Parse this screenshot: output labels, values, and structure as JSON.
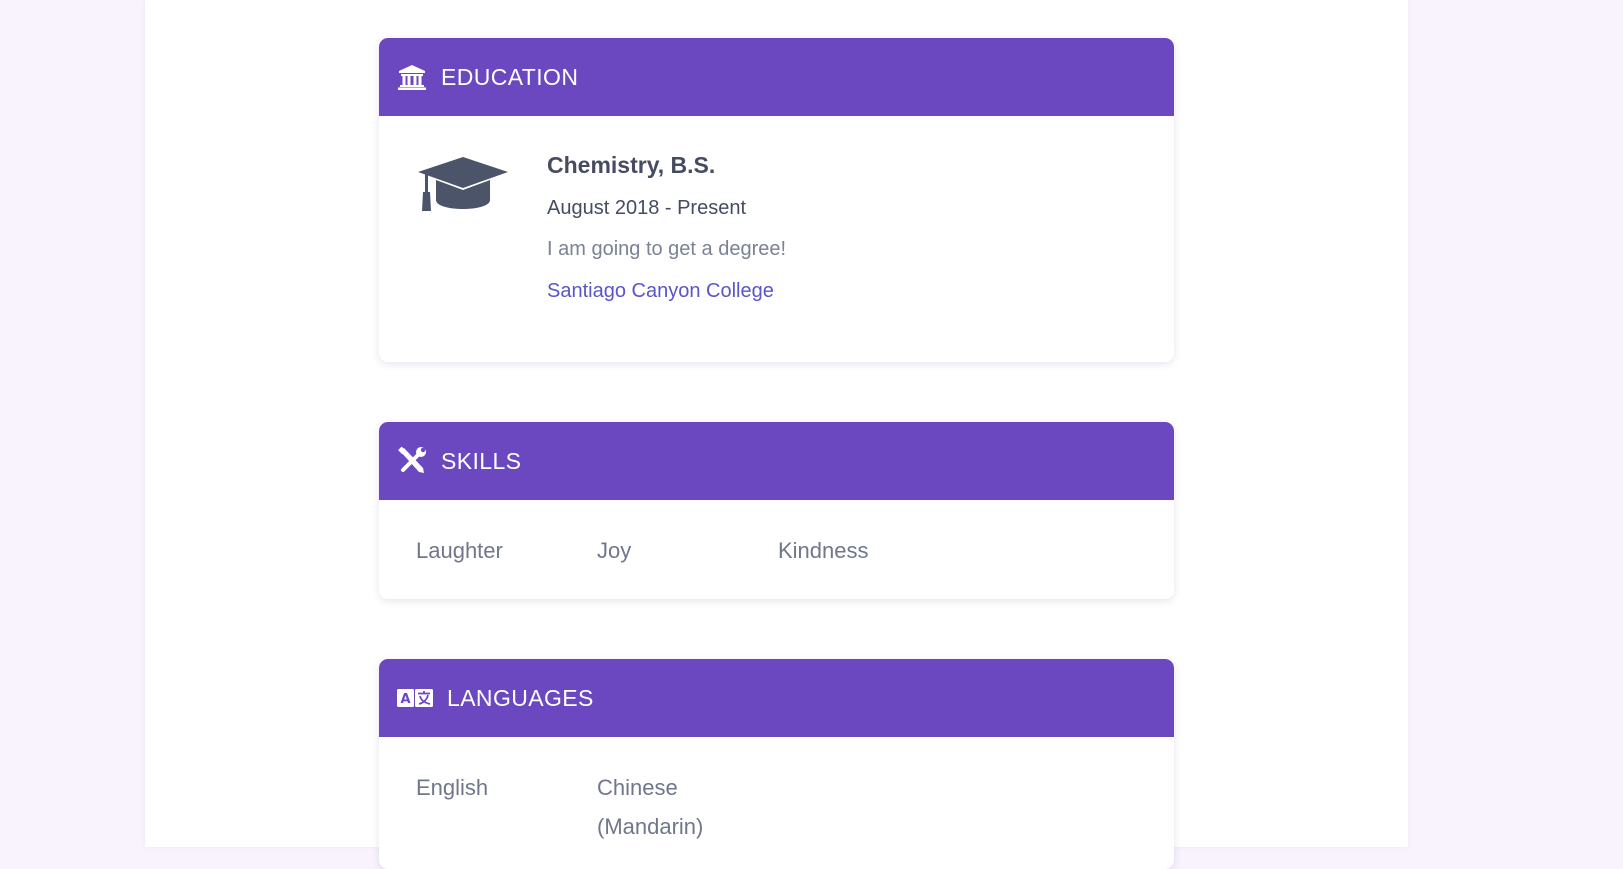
{
  "colors": {
    "page_background": "#f8f3fd",
    "column_background": "#ffffff",
    "header_purple": "#6b48bf",
    "heading_text": "#454c61",
    "muted_text": "#7a8296",
    "link": "#5a55c9"
  },
  "education": {
    "title": "EDUCATION",
    "header_icon": "institution-icon",
    "item_icon": "graduation-cap-icon",
    "degree": "Chemistry, B.S.",
    "dates": "August 2018 - Present",
    "description": "I am going to get a degree!",
    "school": "Santiago Canyon College"
  },
  "skills": {
    "title": "SKILLS",
    "header_icon": "tools-icon",
    "items": [
      "Laughter",
      "Joy",
      "Kindness"
    ]
  },
  "languages": {
    "title": "LANGUAGES",
    "header_icon": "language-icon",
    "items": [
      "English",
      "Chinese (Mandarin)"
    ]
  }
}
